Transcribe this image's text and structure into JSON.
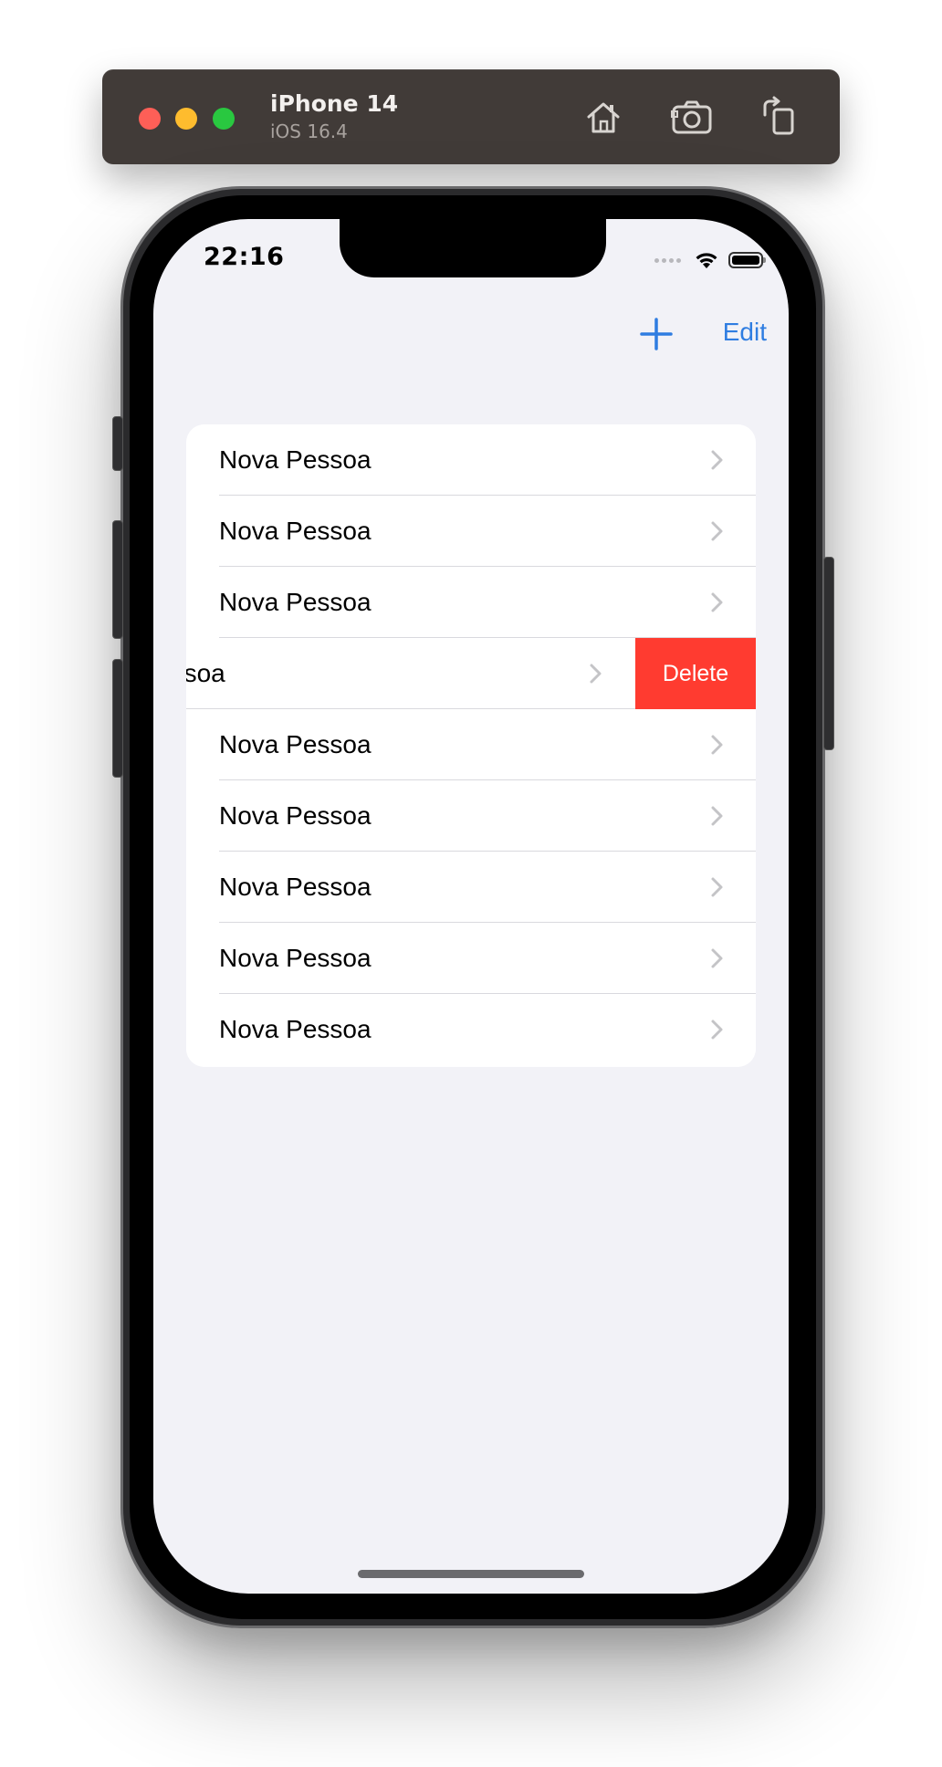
{
  "simulator": {
    "device_name": "iPhone 14",
    "os_version": "iOS 16.4",
    "buttons": [
      "home-icon",
      "screenshot-icon",
      "rotate-icon"
    ]
  },
  "status_bar": {
    "time": "22:16"
  },
  "nav_bar": {
    "add_icon": "plus-icon",
    "edit_label": "Edit",
    "accent_color": "#2f7de1"
  },
  "list": {
    "rows": [
      {
        "label": "Nova Pessoa"
      },
      {
        "label": "Nova Pessoa"
      },
      {
        "label": "Nova Pessoa"
      },
      {
        "label": "Nova Pessoa",
        "swiped": true,
        "visible_label": "essoa"
      },
      {
        "label": "Nova Pessoa"
      },
      {
        "label": "Nova Pessoa"
      },
      {
        "label": "Nova Pessoa"
      },
      {
        "label": "Nova Pessoa"
      },
      {
        "label": "Nova Pessoa"
      }
    ],
    "delete_label": "Delete",
    "delete_color": "#ff3b30"
  }
}
